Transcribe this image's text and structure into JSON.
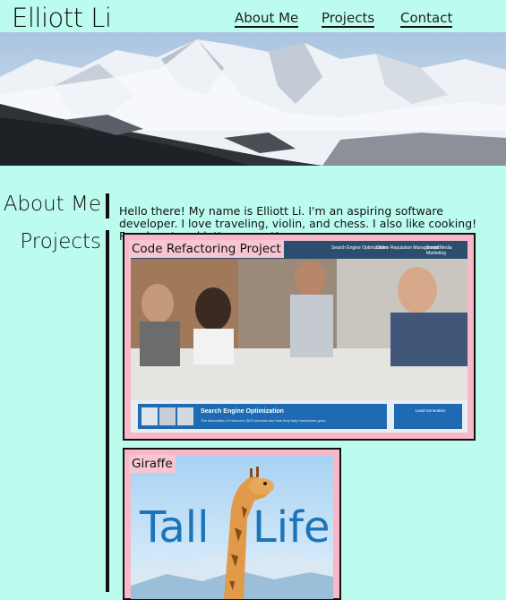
{
  "header": {
    "title": "Elliott Li",
    "nav": [
      "About Me",
      "Projects",
      "Contact"
    ]
  },
  "hero": {
    "icon": "mountain-banner-image"
  },
  "about": {
    "heading": "About Me",
    "text": "Hello there! My name is Elliott Li. I'm an aspiring software developer. I love traveling, violin, and chess. I also like cooking! Reach out and let's connect!"
  },
  "projects": {
    "heading": "Projects",
    "items": [
      {
        "title": "Code Refactoring Project",
        "screenshot": {
          "nav": [
            "Search Engine Optimization",
            "Online Reputation Management",
            "Social Media Marketing"
          ],
          "banner_title": "Search Engine Optimization",
          "banner_text": "The description of Horizon's SEO services and how they help businesses grow.",
          "side_box": "Lead Generation"
        }
      },
      {
        "title": "Giraffe",
        "screenshot": {
          "word1": "Tall",
          "word2": "Life"
        }
      }
    ]
  },
  "colors": {
    "background": "#bbfcef",
    "card": "#f7b8c8",
    "text": "#111111"
  }
}
